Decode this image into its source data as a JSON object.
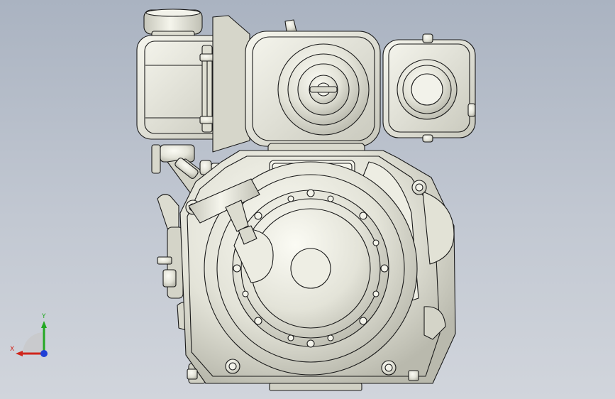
{
  "triad": {
    "x_label": "X",
    "y_label": "Y",
    "x_color": "#d0261c",
    "y_color": "#23a823",
    "z_color": "#1f3fd6"
  },
  "colors": {
    "background_top": "#aab3c1",
    "background_bottom": "#d1d5dc",
    "model_fill": "#e6e6dc",
    "model_shadow": "#b6b6aa",
    "model_edge": "#1a1a1a"
  },
  "icons": {
    "view_triad": "reference-triad-icon"
  }
}
